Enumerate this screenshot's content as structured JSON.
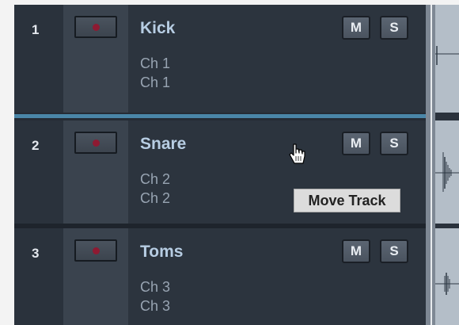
{
  "tracks": [
    {
      "number": "1",
      "name": "Kick",
      "input": "Ch 1",
      "output": "Ch 1",
      "mute_label": "M",
      "solo_label": "S"
    },
    {
      "number": "2",
      "name": "Snare",
      "input": "Ch 2",
      "output": "Ch 2",
      "mute_label": "M",
      "solo_label": "S"
    },
    {
      "number": "3",
      "name": "Toms",
      "input": "Ch 3",
      "output": "Ch 3",
      "mute_label": "M",
      "solo_label": "S"
    }
  ],
  "tooltip": {
    "text": "Move Track"
  },
  "icons": {
    "record": "record-arm-icon",
    "cursor": "hand-cursor-icon"
  },
  "colors": {
    "record_dot": "#8e1a32",
    "selection_line": "#4a86a8",
    "track_name": "#b7cde3"
  }
}
